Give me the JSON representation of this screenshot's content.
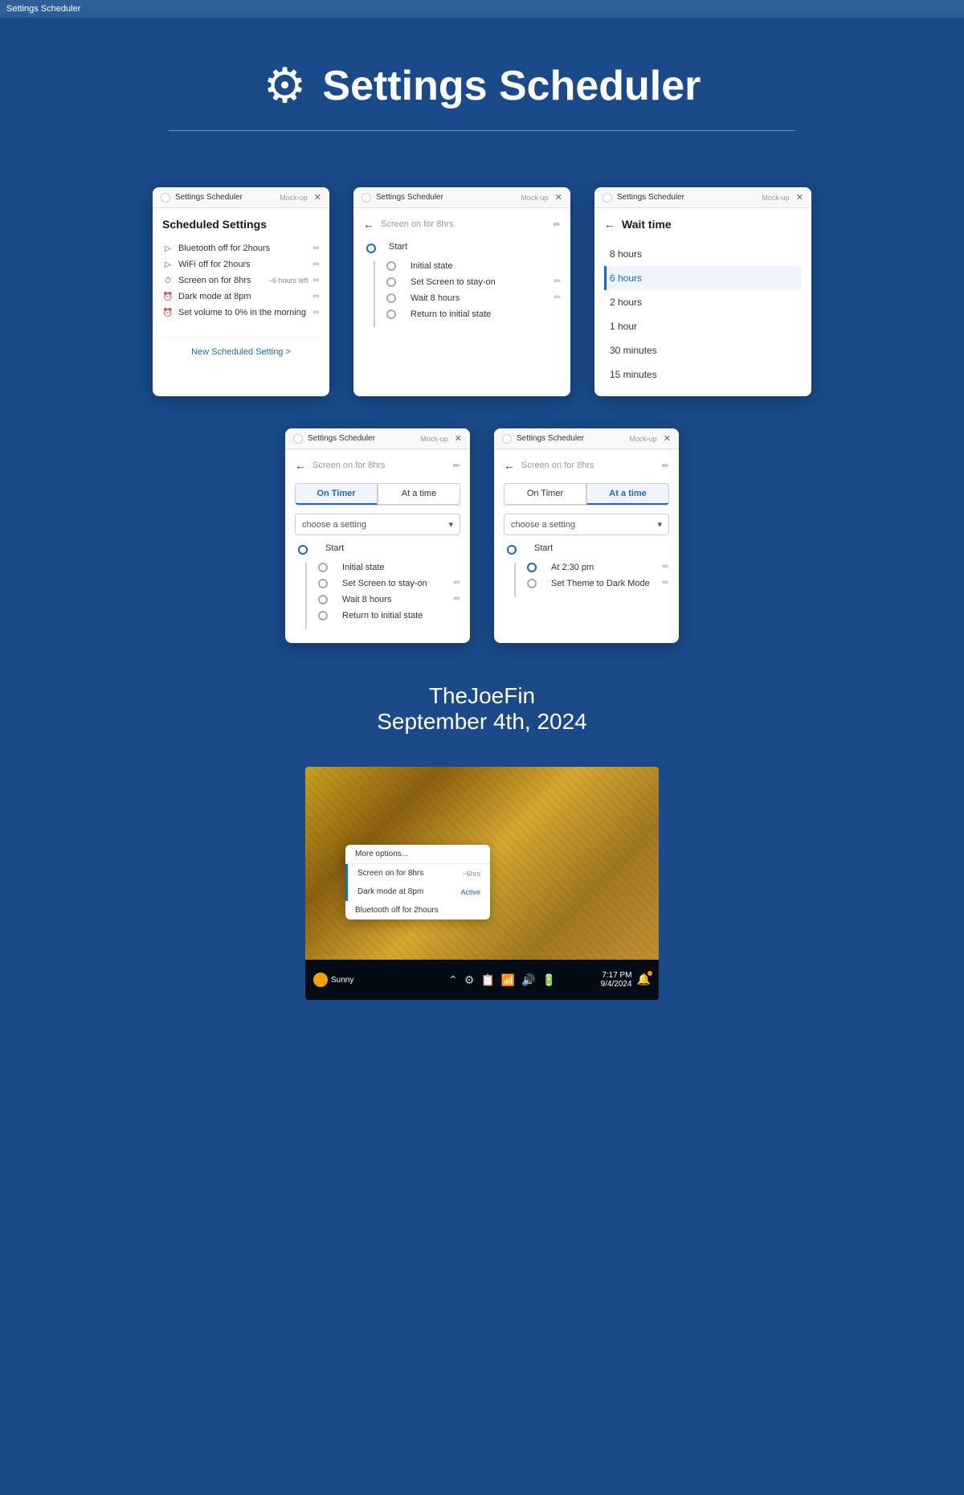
{
  "titlebar": {
    "text": "Settings Scheduler"
  },
  "header": {
    "title": "Settings Scheduler",
    "icon": "⚙"
  },
  "window1": {
    "title": "Settings Scheduler",
    "mock": "Mock-up",
    "section_title": "Scheduled Settings",
    "items": [
      {
        "icon": "▷",
        "label": "Bluetooth off for 2hours",
        "badge": ""
      },
      {
        "icon": "▷",
        "label": "WiFi off for 2hours",
        "badge": ""
      },
      {
        "icon": "⏱",
        "label": "Screen on for 8hrs",
        "badge": "~6 hours left"
      },
      {
        "icon": "⏰",
        "label": "Dark mode at  8pm",
        "badge": ""
      },
      {
        "icon": "⏰",
        "label": "Set volume to 0% in the morning",
        "badge": ""
      }
    ],
    "new_link": "New Scheduled Setting >"
  },
  "window2": {
    "title": "Settings Scheduler",
    "mock": "Mock-up",
    "input_placeholder": "Screen on for 8hrs",
    "timeline": [
      {
        "type": "start",
        "label": "Start"
      },
      {
        "type": "node",
        "label": "Initial state",
        "editable": false
      },
      {
        "type": "node",
        "label": "Set Screen to stay-on",
        "editable": true
      },
      {
        "type": "node",
        "label": "Wait 8 hours",
        "editable": true
      },
      {
        "type": "node",
        "label": "Return to initial state",
        "editable": false
      }
    ]
  },
  "window3": {
    "title": "Settings Scheduler",
    "mock": "Mock-up",
    "back_label": "Wait time",
    "options": [
      {
        "label": "8 hours",
        "selected": false
      },
      {
        "label": "6 hours",
        "selected": true
      },
      {
        "label": "2 hours",
        "selected": false
      },
      {
        "label": "1 hour",
        "selected": false
      },
      {
        "label": "30 minutes",
        "selected": false
      },
      {
        "label": "15 minutes",
        "selected": false
      }
    ]
  },
  "window4": {
    "title": "Settings Scheduler",
    "mock": "Mock-up",
    "input_placeholder": "Screen on for 8hrs",
    "tabs": [
      "On Timer",
      "At a time"
    ],
    "active_tab": 0,
    "dropdown_label": "choose a setting",
    "timeline": [
      {
        "type": "start",
        "label": "Start"
      },
      {
        "type": "node",
        "label": "Initial state",
        "editable": false
      },
      {
        "type": "node",
        "label": "Set Screen to stay-on",
        "editable": true
      },
      {
        "type": "node",
        "label": "Wait 8 hours",
        "editable": true
      },
      {
        "type": "node",
        "label": "Return to initial state",
        "editable": false
      }
    ]
  },
  "window5": {
    "title": "Settings Scheduler",
    "mock": "Mock-up",
    "input_placeholder": "Screen on for 8hrs",
    "tabs": [
      "On Timer",
      "At a time"
    ],
    "active_tab": 1,
    "dropdown_label": "choose a setting",
    "timeline": [
      {
        "type": "start",
        "label": "Start"
      },
      {
        "type": "node",
        "label": "At 2:30 pm",
        "editable": true
      },
      {
        "type": "node",
        "label": "Set Theme to Dark Mode",
        "editable": true
      }
    ]
  },
  "credit": {
    "name": "TheJoeFin",
    "date": "September 4th, 2024"
  },
  "desktop": {
    "context_menu": {
      "more_options": "More options...",
      "items": [
        {
          "label": "Screen on for 8hrs",
          "badge": "~6hrs",
          "indicator": true
        },
        {
          "label": "Dark mode at 8pm",
          "badge": "Active",
          "indicator": true
        },
        {
          "label": "Bluetooth off for 2hours",
          "badge": "",
          "indicator": false
        }
      ]
    },
    "taskbar": {
      "time": "7:17 PM",
      "date": "9/4/2024",
      "weather": "Sunny"
    }
  }
}
